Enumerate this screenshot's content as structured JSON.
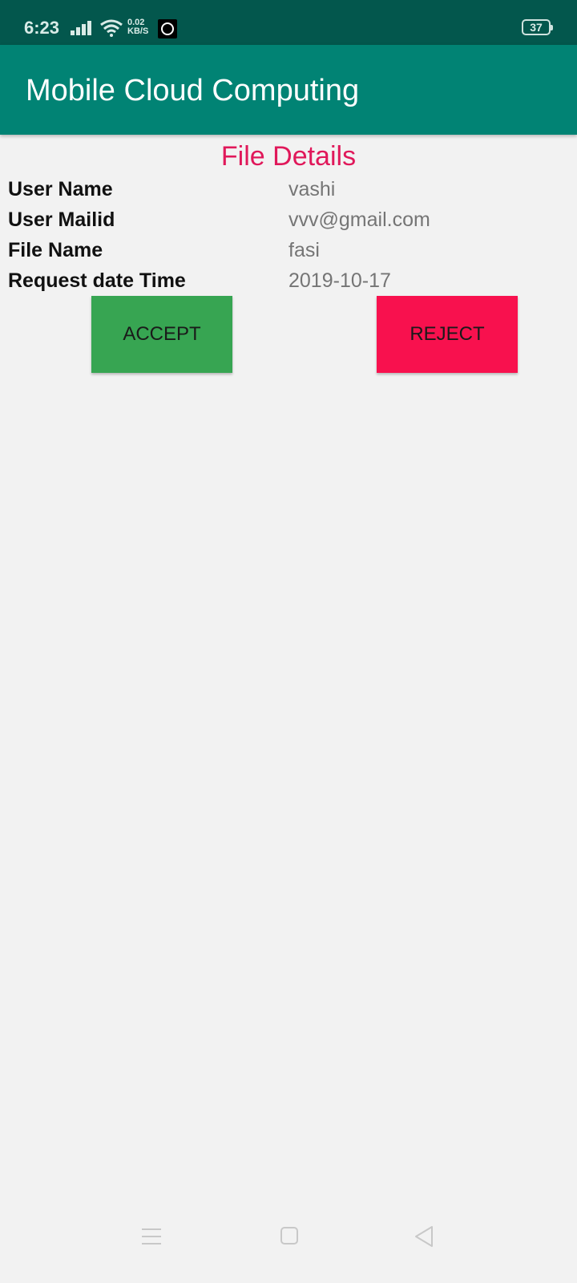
{
  "status_bar": {
    "time": "6:23",
    "speed_value": "0.02",
    "speed_unit": "KB/S",
    "battery": "37"
  },
  "app_bar": {
    "title": "Mobile Cloud Computing"
  },
  "file_details": {
    "title": "File Details",
    "rows": [
      {
        "label": "User Name",
        "value": "vashi"
      },
      {
        "label": "User Mailid",
        "value": "vvv@gmail.com"
      },
      {
        "label": "File Name",
        "value": "fasi"
      },
      {
        "label": "Request date Time",
        "value": "2019-10-17"
      }
    ]
  },
  "actions": {
    "accept_label": "ACCEPT",
    "reject_label": "REJECT"
  },
  "colors": {
    "status_bar": "#03574d",
    "app_bar": "#018374",
    "title_accent": "#e0185a",
    "accept": "#37a552",
    "reject": "#f8114e"
  },
  "icons": {
    "signal": "signal-icon",
    "wifi": "wifi-icon",
    "notification_app": "app-notification-icon",
    "battery": "battery-icon",
    "nav_menu": "menu-icon",
    "nav_home": "home-icon",
    "nav_back": "back-icon"
  }
}
